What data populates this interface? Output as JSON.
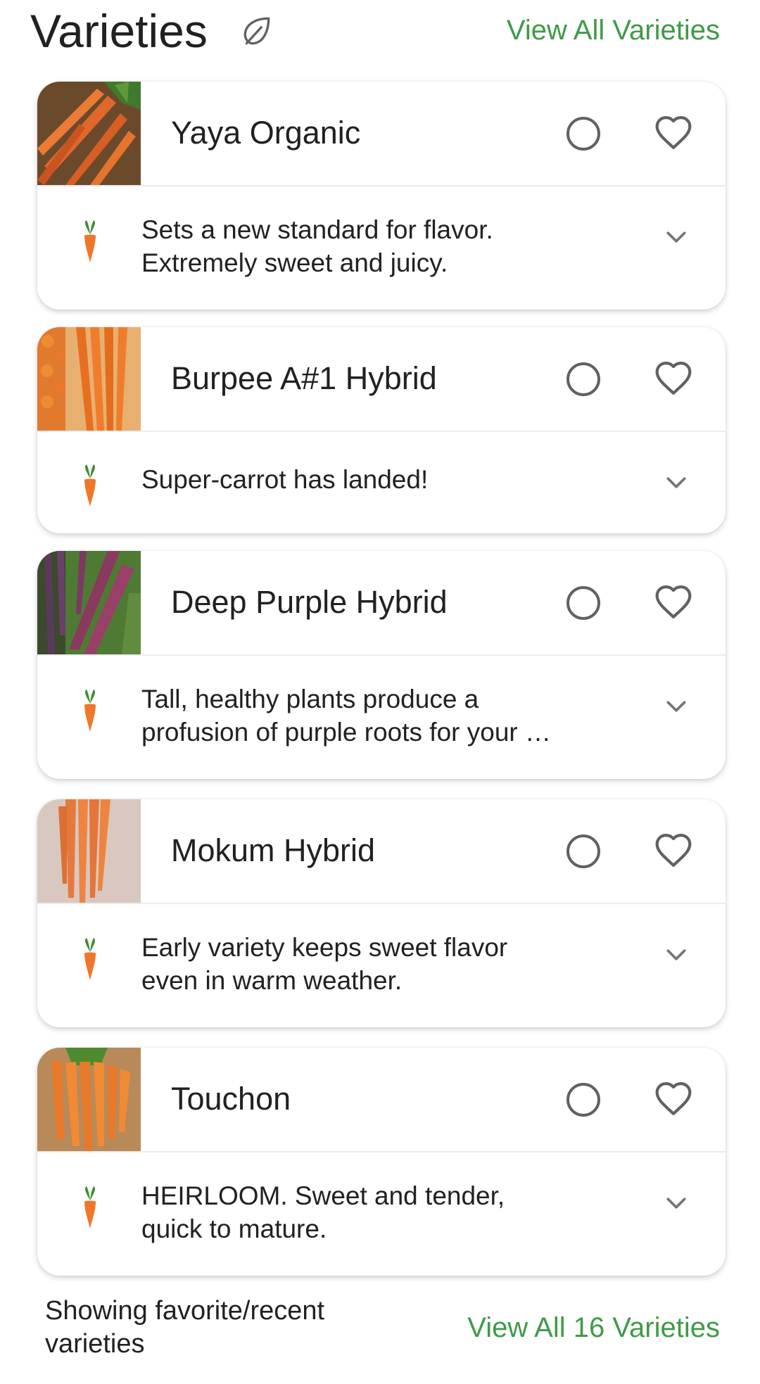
{
  "header": {
    "title": "Varieties",
    "view_all_label": "View All Varieties"
  },
  "colors": {
    "accent_green": "#3f9a47",
    "icon_gray": "#616161"
  },
  "varieties": [
    {
      "name": "Yaya Organic",
      "description_line1": "Sets a new standard for flavor.",
      "description_line2": "Extremely sweet and juicy.",
      "image": "orange-carrots-photo"
    },
    {
      "name": "Burpee A#1 Hybrid",
      "description_line1": "Super-carrot has landed!",
      "description_line2": "",
      "image": "long-orange-carrots-photo"
    },
    {
      "name": "Deep Purple Hybrid",
      "description_line1": "Tall, healthy plants produce a",
      "description_line2": "profusion of purple roots for your …",
      "image": "purple-carrots-photo"
    },
    {
      "name": "Mokum Hybrid",
      "description_line1": "Early variety keeps sweet flavor",
      "description_line2": "even in warm weather.",
      "image": "bunched-carrots-photo"
    },
    {
      "name": "Touchon",
      "description_line1": "HEIRLOOM. Sweet and tender,",
      "description_line2": "quick to mature.",
      "image": "carrot-bunch-photo"
    }
  ],
  "icons": {
    "title": "leaf-icon",
    "select": "circle-outline-icon",
    "favorite": "heart-outline-icon",
    "vegetable": "carrot-icon",
    "expand": "chevron-down-icon"
  },
  "footer": {
    "note_line1": "Showing favorite/recent",
    "note_line2": "varieties",
    "view_all_label": "View All 16 Varieties"
  }
}
